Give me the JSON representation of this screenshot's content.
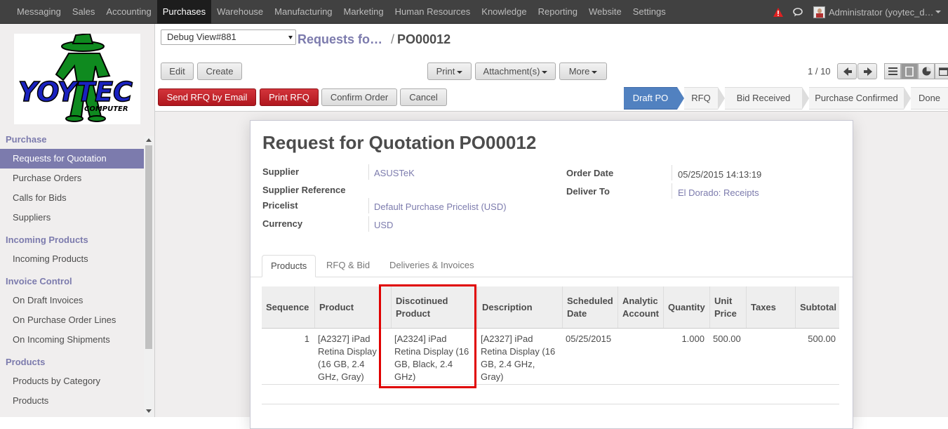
{
  "topmenu": {
    "items": [
      "Messaging",
      "Sales",
      "Accounting",
      "Purchases",
      "Warehouse",
      "Manufacturing",
      "Marketing",
      "Human Resources",
      "Knowledge",
      "Reporting",
      "Website",
      "Settings"
    ],
    "active": "Purchases",
    "user": "Administrator (yoytec_d…"
  },
  "logo": {
    "text": "YOYTEC",
    "subtext": "COMPUTER"
  },
  "sidebar": {
    "sections": [
      {
        "title": "Purchase",
        "items": [
          "Requests for Quotation",
          "Purchase Orders",
          "Calls for Bids",
          "Suppliers"
        ]
      },
      {
        "title": "Incoming Products",
        "items": [
          "Incoming Products"
        ]
      },
      {
        "title": "Invoice Control",
        "items": [
          "On Draft Invoices",
          "On Purchase Order Lines",
          "On Incoming Shipments"
        ]
      },
      {
        "title": "Products",
        "items": [
          "Products by Category",
          "Products"
        ]
      }
    ],
    "active_item": "Requests for Quotation"
  },
  "control": {
    "debug_select": "Debug View#881",
    "breadcrumb_parent": "Requests fo…",
    "breadcrumb_sep": "/",
    "breadcrumb_current": "PO00012",
    "edit": "Edit",
    "create": "Create",
    "print": "Print",
    "attachments": "Attachment(s)",
    "more": "More",
    "pager": "1 / 10"
  },
  "actions": {
    "send_rfq": "Send RFQ by Email",
    "print_rfq": "Print RFQ",
    "confirm": "Confirm Order",
    "cancel": "Cancel"
  },
  "status": {
    "stages": [
      "Draft PO",
      "RFQ",
      "Bid Received",
      "Purchase Confirmed",
      "Done"
    ],
    "current": "Draft PO"
  },
  "form": {
    "title": "Request for Quotation",
    "number": "PO00012",
    "fields": {
      "supplier_label": "Supplier",
      "supplier": "ASUSTeK",
      "supplier_ref_label": "Supplier Reference",
      "supplier_ref": "",
      "pricelist_label": "Pricelist",
      "pricelist": "Default Purchase Pricelist (USD)",
      "currency_label": "Currency",
      "currency": "USD",
      "order_date_label": "Order Date",
      "order_date": "05/25/2015 14:13:19",
      "deliver_to_label": "Deliver To",
      "deliver_to": "El Dorado: Receipts"
    },
    "tabs": [
      "Products",
      "RFQ & Bid",
      "Deliveries & Invoices"
    ],
    "active_tab": "Products"
  },
  "lines": {
    "columns": [
      "Sequence",
      "Product",
      "Discotinued Product",
      "Description",
      "Scheduled Date",
      "Analytic Account",
      "Quantity",
      "Unit Price",
      "Taxes",
      "Subtotal"
    ],
    "rows": [
      {
        "sequence": "1",
        "product": "[A2327] iPad Retina Display (16 GB, 2.4 GHz, Gray)",
        "discontinued": "[A2324] iPad Retina Display (16 GB, Black, 2.4 GHz)",
        "description": "[A2327] iPad Retina Display (16 GB, 2.4 GHz, Gray)",
        "scheduled_date": "05/25/2015",
        "analytic": "",
        "quantity": "1.000",
        "unit_price": "500.00",
        "taxes": "",
        "subtotal": "500.00"
      }
    ]
  },
  "colors": {
    "accent": "#7c7bad",
    "danger": "#c1272d",
    "stage_current": "#5181c0",
    "highlight": "#e00000"
  }
}
